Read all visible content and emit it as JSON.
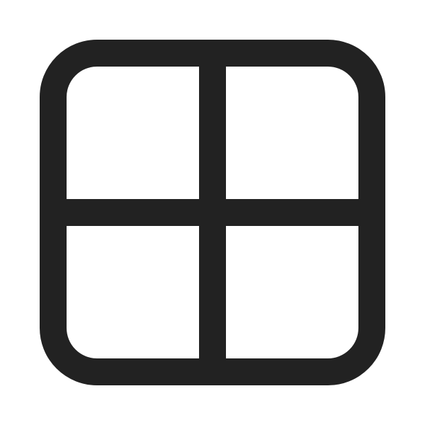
{
  "icon": {
    "name": "grid-2x2-icon",
    "stroke_color": "#222222",
    "background_color": "#ffffff"
  }
}
